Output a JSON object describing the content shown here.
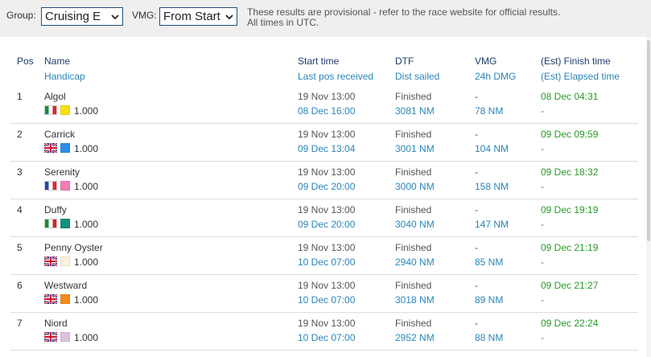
{
  "toolbar": {
    "group_label": "Group:",
    "group_value": "Cruising E",
    "vmg_label": "VMG:",
    "vmg_value": "From Start",
    "notice_line1": "These results are provisional - refer to the race website for official results.",
    "notice_line2": "All times in UTC."
  },
  "columns": {
    "pos": "Pos",
    "name": "Name",
    "handicap": "Handicap",
    "start_time": "Start time",
    "last_pos": "Last pos received",
    "dtf": "DTF",
    "dist_sailed": "Dist sailed",
    "vmg": "VMG",
    "dmg": "24h DMG",
    "finish": "(Est) Finish time",
    "elapsed": "(Est) Elapsed time"
  },
  "rows": [
    {
      "pos": "1",
      "name": "Algol",
      "flag": "it",
      "swatch": "#f7e012",
      "handicap": "1.000",
      "start": "19 Nov 13:00",
      "last": "08 Dec 16:00",
      "dtf": "Finished",
      "dist": "3081 NM",
      "vmg": "-",
      "dmg": "78 NM",
      "finish": "08 Dec 04:31",
      "elapsed": "-"
    },
    {
      "pos": "2",
      "name": "Carrick",
      "flag": "gb",
      "swatch": "#2b8ee8",
      "handicap": "1.000",
      "start": "19 Nov 13:00",
      "last": "09 Dec 13:04",
      "dtf": "Finished",
      "dist": "3001 NM",
      "vmg": "-",
      "dmg": "104 NM",
      "finish": "09 Dec 09:59",
      "elapsed": "-"
    },
    {
      "pos": "3",
      "name": "Serenity",
      "flag": "fr",
      "swatch": "#f27cb4",
      "handicap": "1.000",
      "start": "19 Nov 13:00",
      "last": "09 Dec 20:00",
      "dtf": "Finished",
      "dist": "3000 NM",
      "vmg": "-",
      "dmg": "158 NM",
      "finish": "09 Dec 18:32",
      "elapsed": "-"
    },
    {
      "pos": "4",
      "name": "Duffy",
      "flag": "it",
      "swatch": "#17907a",
      "handicap": "1.000",
      "start": "19 Nov 13:00",
      "last": "09 Dec 20:00",
      "dtf": "Finished",
      "dist": "3040 NM",
      "vmg": "-",
      "dmg": "147 NM",
      "finish": "09 Dec 19:19",
      "elapsed": "-"
    },
    {
      "pos": "5",
      "name": "Penny Oyster",
      "flag": "gb",
      "swatch": "#fbf1dc",
      "handicap": "1.000",
      "start": "19 Nov 13:00",
      "last": "10 Dec 07:00",
      "dtf": "Finished",
      "dist": "2940 NM",
      "vmg": "-",
      "dmg": "85 NM",
      "finish": "09 Dec 21:19",
      "elapsed": "-"
    },
    {
      "pos": "6",
      "name": "Westward",
      "flag": "gb",
      "swatch": "#f58a1f",
      "handicap": "1.000",
      "start": "19 Nov 13:00",
      "last": "10 Dec 07:00",
      "dtf": "Finished",
      "dist": "3018 NM",
      "vmg": "-",
      "dmg": "89 NM",
      "finish": "09 Dec 21:27",
      "elapsed": "-"
    },
    {
      "pos": "7",
      "name": "Niord",
      "flag": "gb",
      "swatch": "#dcc3dc",
      "handicap": "1.000",
      "start": "19 Nov 13:00",
      "last": "10 Dec 07:00",
      "dtf": "Finished",
      "dist": "2952 NM",
      "vmg": "-",
      "dmg": "88 NM",
      "finish": "09 Dec 22:24",
      "elapsed": "-"
    }
  ]
}
